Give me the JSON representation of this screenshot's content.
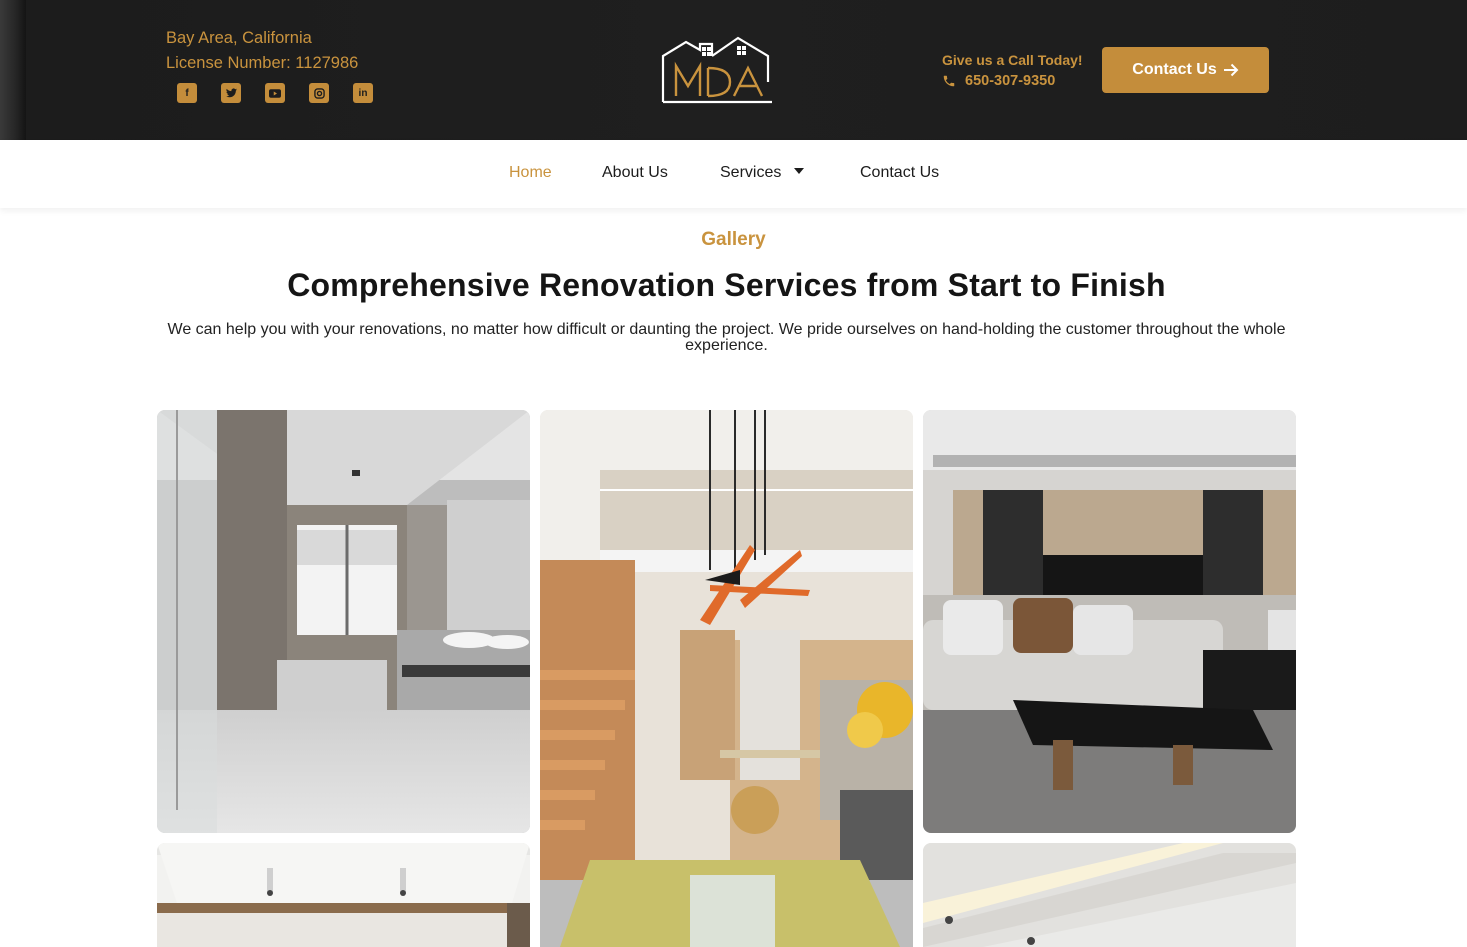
{
  "header": {
    "location": "Bay Area, California",
    "license": "License Number: 1127986",
    "socials": [
      {
        "name": "facebook-icon",
        "glyph": "f"
      },
      {
        "name": "twitter-icon",
        "glyph": "t"
      },
      {
        "name": "youtube-icon",
        "glyph": "▶"
      },
      {
        "name": "instagram-icon",
        "glyph": "◎"
      },
      {
        "name": "linkedin-icon",
        "glyph": "in"
      }
    ],
    "logo_text": "MDA",
    "call_label": "Give us a Call Today!",
    "phone": "650-307-9350",
    "cta_label": "Contact Us",
    "accent": "#c48d3b",
    "bg": "#1d1d1d"
  },
  "nav": {
    "items": [
      {
        "label": "Home",
        "active": true
      },
      {
        "label": "About Us"
      },
      {
        "label": "Services",
        "dropdown": true
      },
      {
        "label": "Contact Us"
      }
    ]
  },
  "main": {
    "eyebrow": "Gallery",
    "title": "Comprehensive Renovation Services from Start to Finish",
    "description": "We can help you with your renovations, no matter how difficult or daunting the project. We pride ourselves on hand-holding the customer throughout the whole experience.",
    "gallery": [
      {
        "name": "gallery-image-bathroom"
      },
      {
        "name": "gallery-image-loft-living"
      },
      {
        "name": "gallery-image-living-room"
      },
      {
        "name": "gallery-image-room-ceiling"
      },
      {
        "name": "gallery-image-ceiling-light"
      }
    ]
  }
}
